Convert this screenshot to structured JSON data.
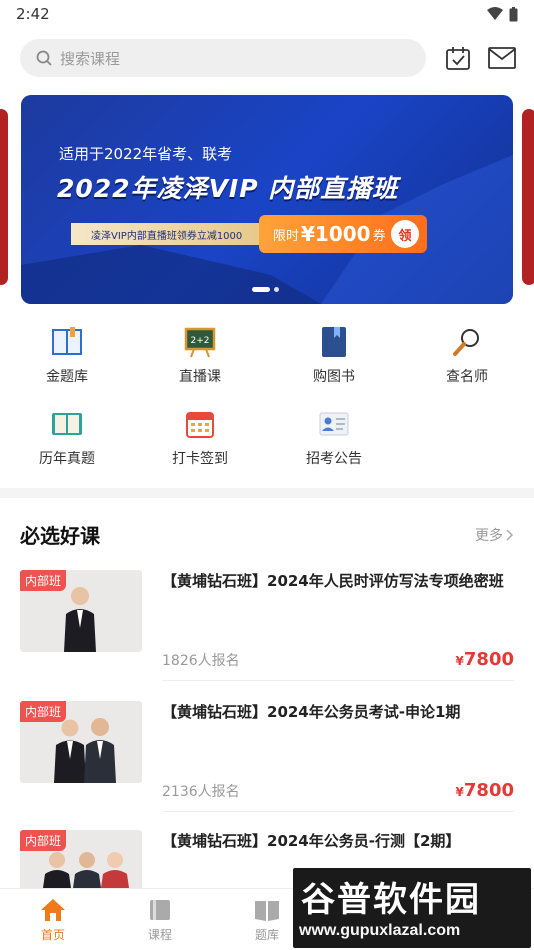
{
  "status": {
    "time": "2:42"
  },
  "search": {
    "placeholder": "搜索课程"
  },
  "banner": {
    "subtitle": "适用于2022年省考、联考",
    "title": "2022年凌泽VIP 内部直播班",
    "strip_text": "凌泽VIP内部直播班领券立减1000",
    "coupon_prefix": "限时",
    "coupon_price": "¥1000",
    "coupon_suffix": "券",
    "coupon_get": "领",
    "slide_count": 2,
    "active_slide": 1
  },
  "grid": [
    {
      "label": "金题库",
      "icon": "book-icon"
    },
    {
      "label": "直播课",
      "icon": "live-board-icon"
    },
    {
      "label": "购图书",
      "icon": "bookmark-book-icon"
    },
    {
      "label": "查名师",
      "icon": "magnifier-icon"
    },
    {
      "label": "历年真题",
      "icon": "open-book-icon"
    },
    {
      "label": "打卡签到",
      "icon": "calendar-icon"
    },
    {
      "label": "招考公告",
      "icon": "id-card-icon"
    }
  ],
  "section": {
    "title": "必选好课",
    "more": "更多"
  },
  "courses": [
    {
      "badge": "内部班",
      "title": "【黄埔钻石班】2024年人民时评仿写法专项绝密班",
      "count": "1826人报名",
      "currency": "¥",
      "price": "7800"
    },
    {
      "badge": "内部班",
      "title": "【黄埔钻石班】2024年公务员考试-申论1期",
      "count": "2136人报名",
      "currency": "¥",
      "price": "7800"
    },
    {
      "badge": "内部班",
      "title": "【黄埔钻石班】2024年公务员-行测【2期】",
      "count": "",
      "currency": "",
      "price": ""
    }
  ],
  "bottom_nav": [
    {
      "label": "首页",
      "icon": "home-icon",
      "active": true
    },
    {
      "label": "课程",
      "icon": "course-icon",
      "active": false
    },
    {
      "label": "题库",
      "icon": "question-bank-icon",
      "active": false
    }
  ],
  "watermark": {
    "main": "谷普软件园",
    "url": "www.gupuxlazal.com"
  },
  "colors": {
    "accent": "#f07a1a",
    "price": "#e53935",
    "badge": "#ef5350",
    "banner": "#1a44c6"
  }
}
